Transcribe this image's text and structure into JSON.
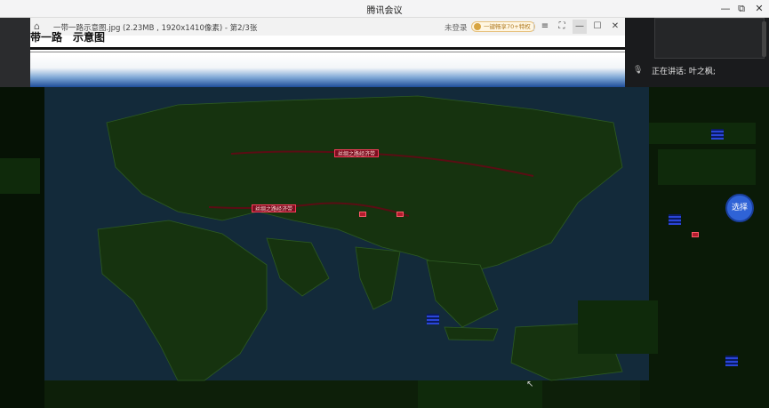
{
  "meeting": {
    "app_title": "腾讯会议",
    "window_buttons": [
      "—",
      "⧉",
      "✕"
    ]
  },
  "viewer": {
    "file_title": "一带一路示意图.jpg (2.23MB , 1920x1410像素) - 第2/3张",
    "login_label": "未登录",
    "upgrade_label": "一键畅享70+特权",
    "controls": [
      "≡",
      "⛶",
      "—",
      "☐",
      "✕"
    ],
    "doc_heading": "带一路　示意图"
  },
  "right_panel": {
    "speaking_label": "正在讲话: 叶之枫;"
  },
  "map": {
    "route_labels": [
      "丝绸之路经济带",
      "丝绸之路经济带"
    ],
    "float_button_label": "选择"
  },
  "colors": {
    "map_land": "#16330f",
    "map_sea": "#132a3a",
    "route": "#a3182c",
    "accent_blue": "#2f63d6"
  }
}
